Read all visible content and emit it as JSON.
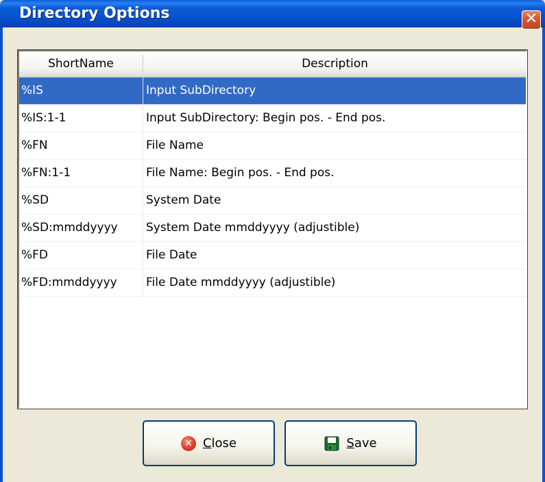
{
  "window": {
    "title": "Directory Options",
    "close_glyph": "✕"
  },
  "list": {
    "columns": [
      "ShortName",
      "Description"
    ],
    "rows": [
      {
        "short": "%IS",
        "desc": "Input SubDirectory",
        "selected": true
      },
      {
        "short": "%IS:1-1",
        "desc": "Input SubDirectory: Begin pos. - End pos.",
        "selected": false
      },
      {
        "short": "%FN",
        "desc": "File Name",
        "selected": false
      },
      {
        "short": "%FN:1-1",
        "desc": "File Name: Begin pos. - End pos.",
        "selected": false
      },
      {
        "short": "%SD",
        "desc": "System Date",
        "selected": false
      },
      {
        "short": "%SD:mmddyyyy",
        "desc": "System Date mmddyyyy (adjustible)",
        "selected": false
      },
      {
        "short": "%FD",
        "desc": "File Date",
        "selected": false
      },
      {
        "short": "%FD:mmddyyyy",
        "desc": "File Date mmddyyyy (adjustible)",
        "selected": false
      }
    ]
  },
  "buttons": {
    "close": {
      "label_mnemonic": "C",
      "label_rest": "lose",
      "icon": "close-icon",
      "icon_glyph": "✕"
    },
    "save": {
      "label_mnemonic": "S",
      "label_rest": "ave",
      "icon": "floppy-disk-icon"
    }
  },
  "colors": {
    "titlebar": "#0553cf",
    "selection": "#316ac5",
    "dialog_bg": "#ece9d8"
  }
}
